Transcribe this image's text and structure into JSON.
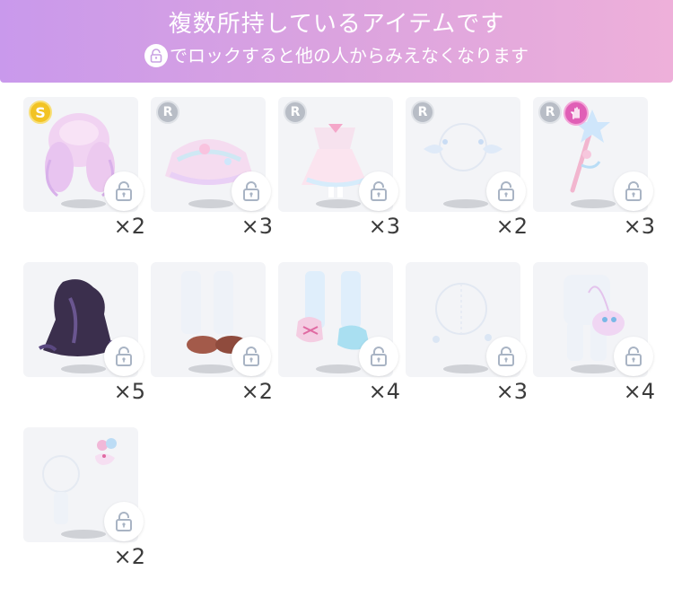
{
  "header": {
    "title": "複数所持しているアイテムです",
    "subtitle": "でロックすると他の人からみえなくなります"
  },
  "colors": {
    "header_gradient_start": "#c999ec",
    "header_gradient_end": "#eeb0da",
    "card_bg": "#f3f4f7",
    "rank_r": "#b8bdc6",
    "rank_s": "#f2c323",
    "hand_badge": "#e05fb6"
  },
  "items": [
    {
      "rank": "S",
      "count": "×2",
      "icon": "pink-hair-icon"
    },
    {
      "rank": "R",
      "count": "×3",
      "icon": "frilly-skirt-icon"
    },
    {
      "rank": "R",
      "count": "×3",
      "icon": "pastel-dress-icon"
    },
    {
      "rank": "R",
      "count": "×2",
      "icon": "ribbon-accessory-icon"
    },
    {
      "rank": "R",
      "count": "×3",
      "icon": "magic-wand-icon"
    },
    {
      "rank": "",
      "count": "×5",
      "icon": "dark-cloak-icon"
    },
    {
      "rank": "",
      "count": "×2",
      "icon": "brown-shoes-icon"
    },
    {
      "rank": "",
      "count": "×4",
      "icon": "ribbon-shoes-icon"
    },
    {
      "rank": "",
      "count": "×3",
      "icon": "bubble-accessory-icon"
    },
    {
      "rank": "",
      "count": "×4",
      "icon": "pastel-bag-icon"
    },
    {
      "rank": "",
      "count": "×2",
      "icon": "hair-clip-icon"
    }
  ]
}
